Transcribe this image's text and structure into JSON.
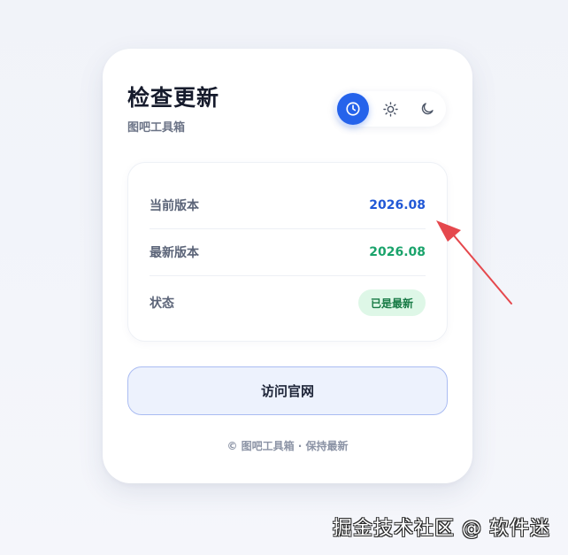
{
  "header": {
    "title": "检查更新",
    "subtitle": "图吧工具箱"
  },
  "theme_switch": {
    "options": [
      {
        "icon": "clock-icon",
        "selected": true
      },
      {
        "icon": "sun-icon",
        "selected": false
      },
      {
        "icon": "moon-icon",
        "selected": false
      }
    ]
  },
  "info": {
    "current_label": "当前版本",
    "current_value": "2026.08",
    "latest_label": "最新版本",
    "latest_value": "2026.08",
    "status_label": "状态",
    "status_value": "已是最新"
  },
  "actions": {
    "visit_label": "访问官网"
  },
  "footer": {
    "text": "© 图吧工具箱 · 保持最新"
  },
  "watermark": {
    "text": "掘金技术社区 @ 软件迷"
  },
  "colors": {
    "accent": "#2563eb",
    "current_version": "#2158d6",
    "latest_version": "#1aa36b",
    "badge_bg": "#def7e7",
    "badge_text": "#177a45",
    "arrow": "#e5484d"
  }
}
